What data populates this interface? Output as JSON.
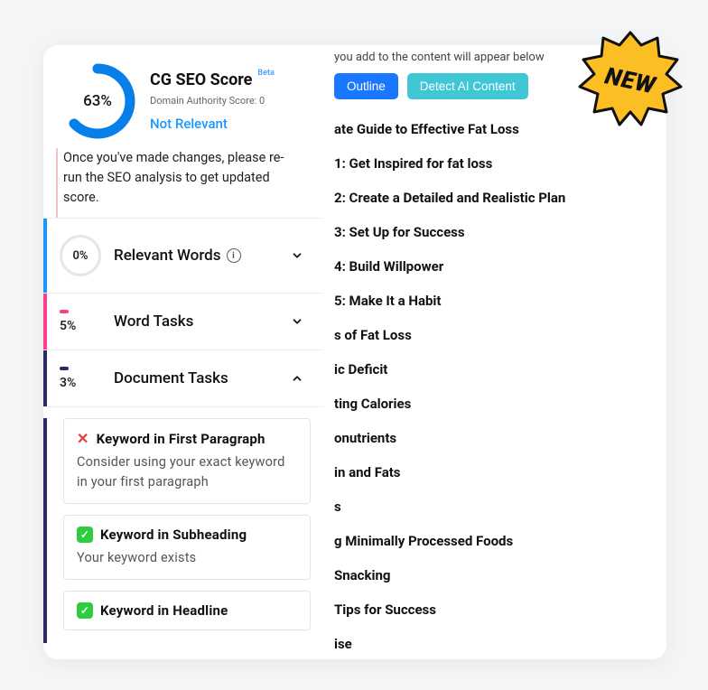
{
  "badge": {
    "text": "NEW"
  },
  "score": {
    "percent_label": "63%",
    "percent_value": 63,
    "title": "CG SEO Score",
    "beta": "Beta",
    "domain_authority": "Domain Authority Score: 0",
    "relevance": "Not Relevant"
  },
  "hint": "Once you've made changes, please re-run the SEO analysis to get updated score.",
  "accordion": {
    "relevant_words": {
      "pct": "0%",
      "label": "Relevant Words",
      "expanded": false
    },
    "word_tasks": {
      "pct": "5%",
      "label": "Word Tasks",
      "expanded": false
    },
    "document_tasks": {
      "pct": "3%",
      "label": "Document Tasks",
      "expanded": true
    }
  },
  "doc_tasks": [
    {
      "status": "fail",
      "title": "Keyword in First Paragraph",
      "desc": "Consider using your exact keyword in your first paragraph"
    },
    {
      "status": "pass",
      "title": "Keyword in Subheading",
      "desc": "Your keyword exists"
    },
    {
      "status": "pass",
      "title": "Keyword in Headline",
      "desc": ""
    }
  ],
  "main": {
    "clipped_top": "you add to the content will appear below",
    "buttons": {
      "outline": "Outline",
      "detect": "Detect AI Content"
    },
    "headings_truncated": [
      "ate Guide to Effective Fat Loss",
      "1: Get Inspired for fat loss",
      "2: Create a Detailed and Realistic Plan",
      "3: Set Up for Success",
      "4: Build Willpower",
      "5: Make It a Habit",
      "s of Fat Loss",
      "ic Deficit",
      "ting Calories",
      "onutrients",
      "in and Fats",
      "s",
      "g Minimally Processed Foods",
      "Snacking",
      "Tips for Success",
      "ise"
    ]
  },
  "colors": {
    "primary_blue": "#1a77ff",
    "light_blue": "#1a97ff",
    "teal": "#3fc7d6",
    "pink": "#ff3d8b",
    "navy": "#2a2a60",
    "badge_yellow": "#fbbf24"
  }
}
